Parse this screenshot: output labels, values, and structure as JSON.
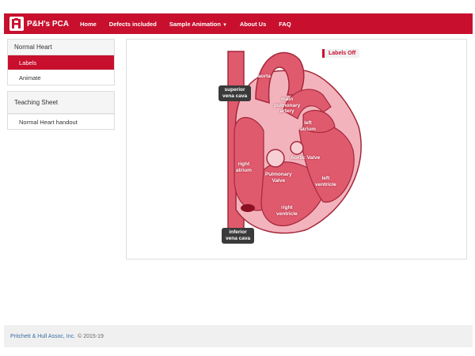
{
  "nav": {
    "brand": "P&H's PCA",
    "items": [
      {
        "label": "Home"
      },
      {
        "label": "Defects included"
      },
      {
        "label": "Sample Animation",
        "caret": "▼"
      },
      {
        "label": "About Us"
      },
      {
        "label": "FAQ"
      }
    ]
  },
  "sidebar": {
    "panel1": {
      "title": "Normal Heart",
      "items": [
        {
          "label": "Labels",
          "active": true
        },
        {
          "label": "Animate",
          "active": false
        }
      ]
    },
    "panel2": {
      "title": "Teaching Sheet",
      "items": [
        {
          "label": "Normal Heart handout"
        }
      ]
    }
  },
  "main": {
    "labels_toggle": "Labels Off",
    "diagram_labels": {
      "superior_vena_cava": "superior\nvena cava",
      "aorta": "aorta",
      "main_pulmonary_artery": "main\npulmonary\nartery",
      "left_atrium": "left\natrium",
      "right_atrium": "right\natrium",
      "aortic_valve": "Aortic Valve",
      "pulmonary_valve": "Pulmonary\nValve",
      "left_ventricle": "left\nventricle",
      "right_ventricle": "right\nventricle",
      "inferior_vena_cava": "inferior\nvena cava"
    }
  },
  "footer": {
    "company": "Pritchett & Hull Assoc, Inc.",
    "copyright": "© 2015-19"
  },
  "colors": {
    "brand_red": "#c8102e",
    "heart_fill": "#e05a6e",
    "heart_light": "#f3b3bd",
    "callout_bg": "#3a3a3a"
  }
}
